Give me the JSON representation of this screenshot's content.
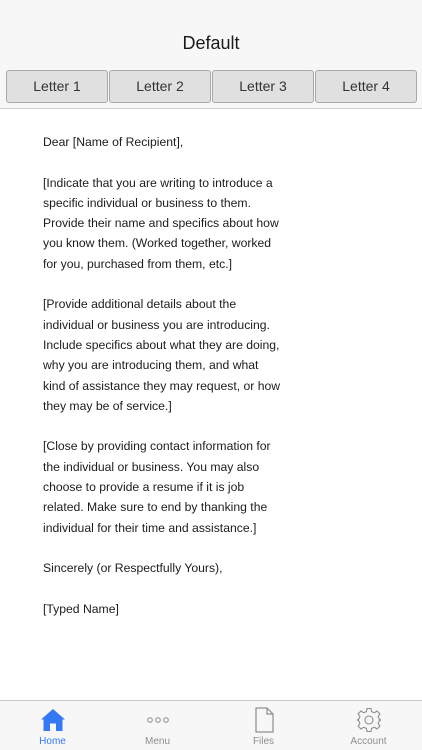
{
  "header": {
    "title": "Default"
  },
  "segments": [
    {
      "label": "Letter 1"
    },
    {
      "label": "Letter 2"
    },
    {
      "label": "Letter 3"
    },
    {
      "label": "Letter 4"
    }
  ],
  "letter": {
    "salutation": "Dear [Name of Recipient],",
    "paragraphs": [
      "[Indicate that you are writing to introduce a specific individual or business to them. Provide their name and specifics about how you know them. (Worked together, worked for you, purchased from them, etc.]",
      "[Provide additional details about the individual or business you are introducing. Include specifics about what they are doing, why you are introducing them, and what kind of assistance they may request, or how they may be of service.]",
      "[Close by providing contact information for the individual or business. You may also choose to provide a resume if it is job related. Make sure to end by thanking the individual for their time and assistance.]"
    ],
    "closing": "Sincerely (or Respectfully Yours),",
    "signature": "[Typed Name]"
  },
  "tabbar": {
    "items": [
      {
        "label": "Home",
        "icon": "home-icon"
      },
      {
        "label": "Menu",
        "icon": "dots-icon"
      },
      {
        "label": "Files",
        "icon": "file-icon"
      },
      {
        "label": "Account",
        "icon": "gear-icon"
      }
    ],
    "active_color": "#3478f6",
    "inactive_color": "#8e8e8e"
  }
}
